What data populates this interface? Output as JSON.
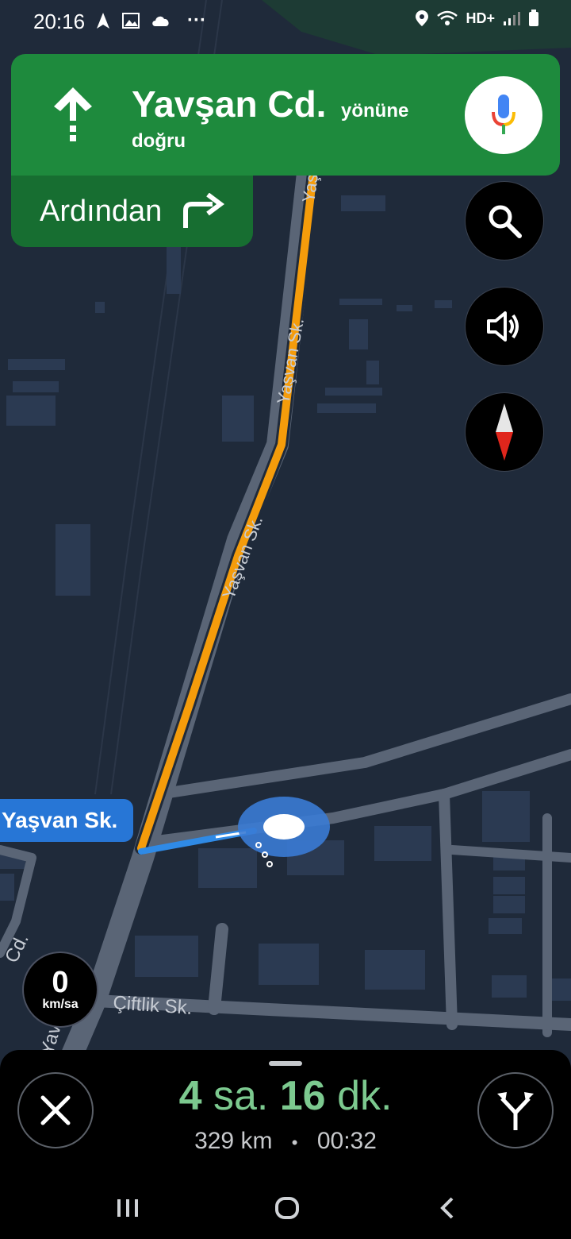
{
  "status_bar": {
    "time": "20:16",
    "network": "HD+"
  },
  "instruction": {
    "road": "Yavşan Cd.",
    "direction_part1": "yönüne",
    "direction_part2": "doğru",
    "maneuver_icon": "straight-arrow-icon"
  },
  "then": {
    "label": "Ardından",
    "maneuver_icon": "turn-right-icon"
  },
  "map": {
    "street_labels": [
      "Yaşvan Sk.",
      "Yaşvan Sk.",
      "Yaşvan Sk.",
      "Çiftlik Sk.",
      "Yavşan Cd.",
      "Cd."
    ],
    "current_road_label": "Yaşvan Sk.",
    "route_color": "#f59c0b",
    "next_route_color": "#2f8ae6",
    "location_color": "#3a7bd5"
  },
  "buttons": {
    "search_icon": "search-icon",
    "sound_icon": "volume-icon",
    "compass_icon": "compass-icon"
  },
  "speed": {
    "value": "0",
    "unit": "km/sa"
  },
  "trip": {
    "hours": "4",
    "hours_unit": "sa.",
    "minutes": "16",
    "minutes_unit": "dk.",
    "distance": "329 km",
    "separator": "•",
    "arrival": "00:32"
  },
  "colors": {
    "banner_green": "#1e8a3d",
    "then_green": "#176e31",
    "eta_green": "#7cc98f"
  }
}
